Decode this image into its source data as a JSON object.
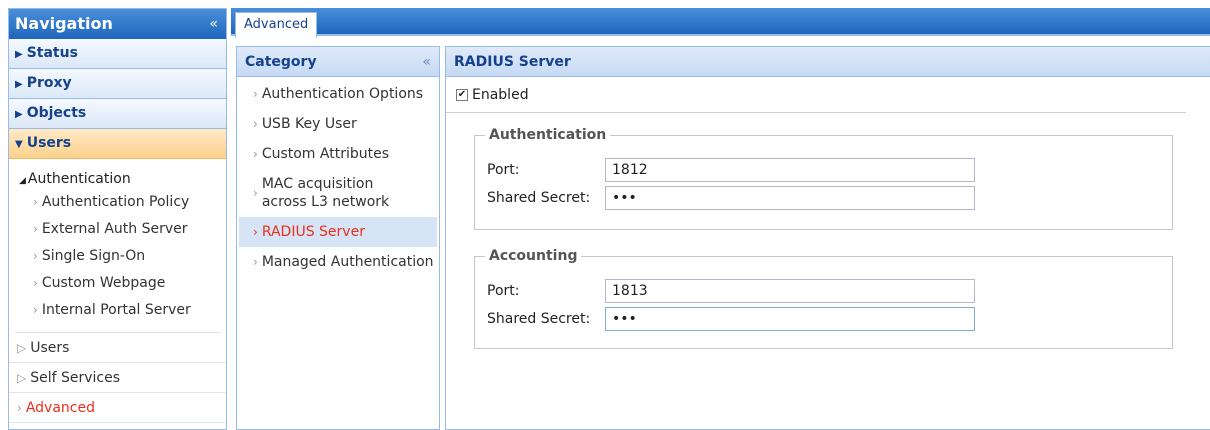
{
  "nav": {
    "title": "Navigation",
    "collapse_glyph": "«",
    "sections": [
      {
        "label": "Status"
      },
      {
        "label": "Proxy"
      },
      {
        "label": "Objects"
      },
      {
        "label": "Users"
      }
    ],
    "tree": {
      "group_label": "Authentication",
      "group_items": [
        "Authentication Policy",
        "External Auth Server",
        "Single Sign-On",
        "Custom Webpage",
        "Internal Portal Server"
      ],
      "roots": [
        "Users",
        "Self Services",
        "Advanced"
      ]
    }
  },
  "tabs": [
    {
      "label": "Advanced"
    }
  ],
  "category": {
    "title": "Category",
    "collapse_glyph": "«",
    "items": [
      "Authentication Options",
      "USB Key User",
      "Custom Attributes",
      "MAC acquisition across L3 network",
      "RADIUS Server",
      "Managed Authentication"
    ],
    "active": "RADIUS Server"
  },
  "radius": {
    "title": "RADIUS Server",
    "enabled_label": "Enabled",
    "enabled": true,
    "authentication": {
      "legend": "Authentication",
      "port_label": "Port:",
      "port_value": "1812",
      "secret_label": "Shared Secret:",
      "secret_value": "•••"
    },
    "accounting": {
      "legend": "Accounting",
      "port_label": "Port:",
      "port_value": "1813",
      "secret_label": "Shared Secret:",
      "secret_value": "•••"
    }
  },
  "colors": {
    "nav_header": "#1f66bd",
    "active_section": "#fbd18c",
    "active_link": "#e8301c"
  }
}
